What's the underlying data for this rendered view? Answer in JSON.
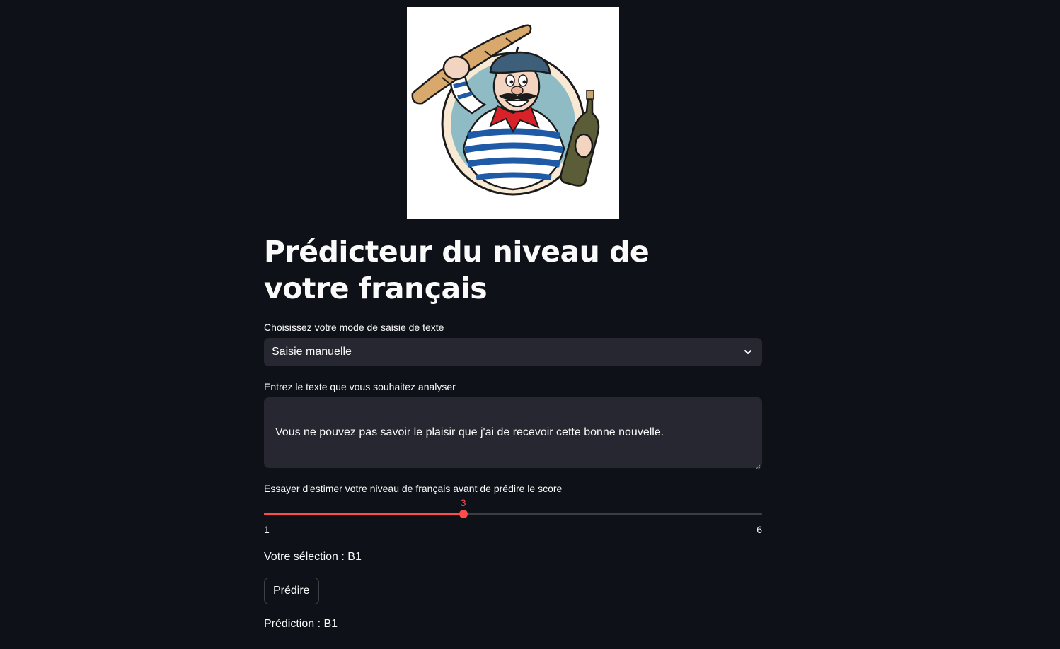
{
  "page": {
    "title": "Prédicteur du niveau de votre français"
  },
  "image": {
    "icon": "french-man-with-baguette-and-wine-illustration"
  },
  "input_mode": {
    "label": "Choisissez votre mode de saisie de texte",
    "selected": "Saisie manuelle"
  },
  "text_input": {
    "label": "Entrez le texte que vous souhaitez analyser",
    "value": "Vous ne pouvez pas savoir le plaisir que j'ai de recevoir cette bonne nouvelle."
  },
  "level_slider": {
    "label": "Essayer d'estimer votre niveau de français avant de prédire le score",
    "value": 3,
    "value_label": "3",
    "min": 1,
    "max": 6,
    "min_label": "1",
    "max_label": "6"
  },
  "selection": {
    "text": "Votre sélection : B1"
  },
  "predict_button": {
    "label": "Prédire"
  },
  "prediction": {
    "text": "Prédiction : B1"
  },
  "colors": {
    "background": "#0e1117",
    "widget": "#262730",
    "accent": "#ff4b4b",
    "text": "#fafafa"
  }
}
